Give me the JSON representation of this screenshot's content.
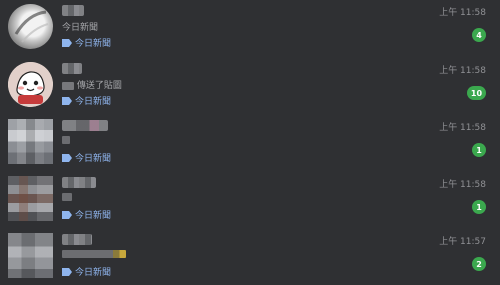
{
  "chats": [
    {
      "preview": "今日新聞",
      "tag": "今日新聞",
      "time": "上午 11:58",
      "unread": "4"
    },
    {
      "preview": "傳送了貼圖",
      "tag": "今日新聞",
      "time": "上午 11:58",
      "unread": "10"
    },
    {
      "preview": "",
      "tag": "今日新聞",
      "time": "上午 11:58",
      "unread": "1"
    },
    {
      "preview": "",
      "tag": "今日新聞",
      "time": "上午 11:58",
      "unread": "1"
    },
    {
      "preview": "",
      "tag": "今日新聞",
      "time": "上午 11:57",
      "unread": "2"
    }
  ],
  "colors": {
    "background": "#2f3033",
    "badge": "#3ba84e",
    "tag_text": "#8fb5ee",
    "time_text": "#909195"
  },
  "icons": {
    "tag": "label-tag-icon"
  }
}
